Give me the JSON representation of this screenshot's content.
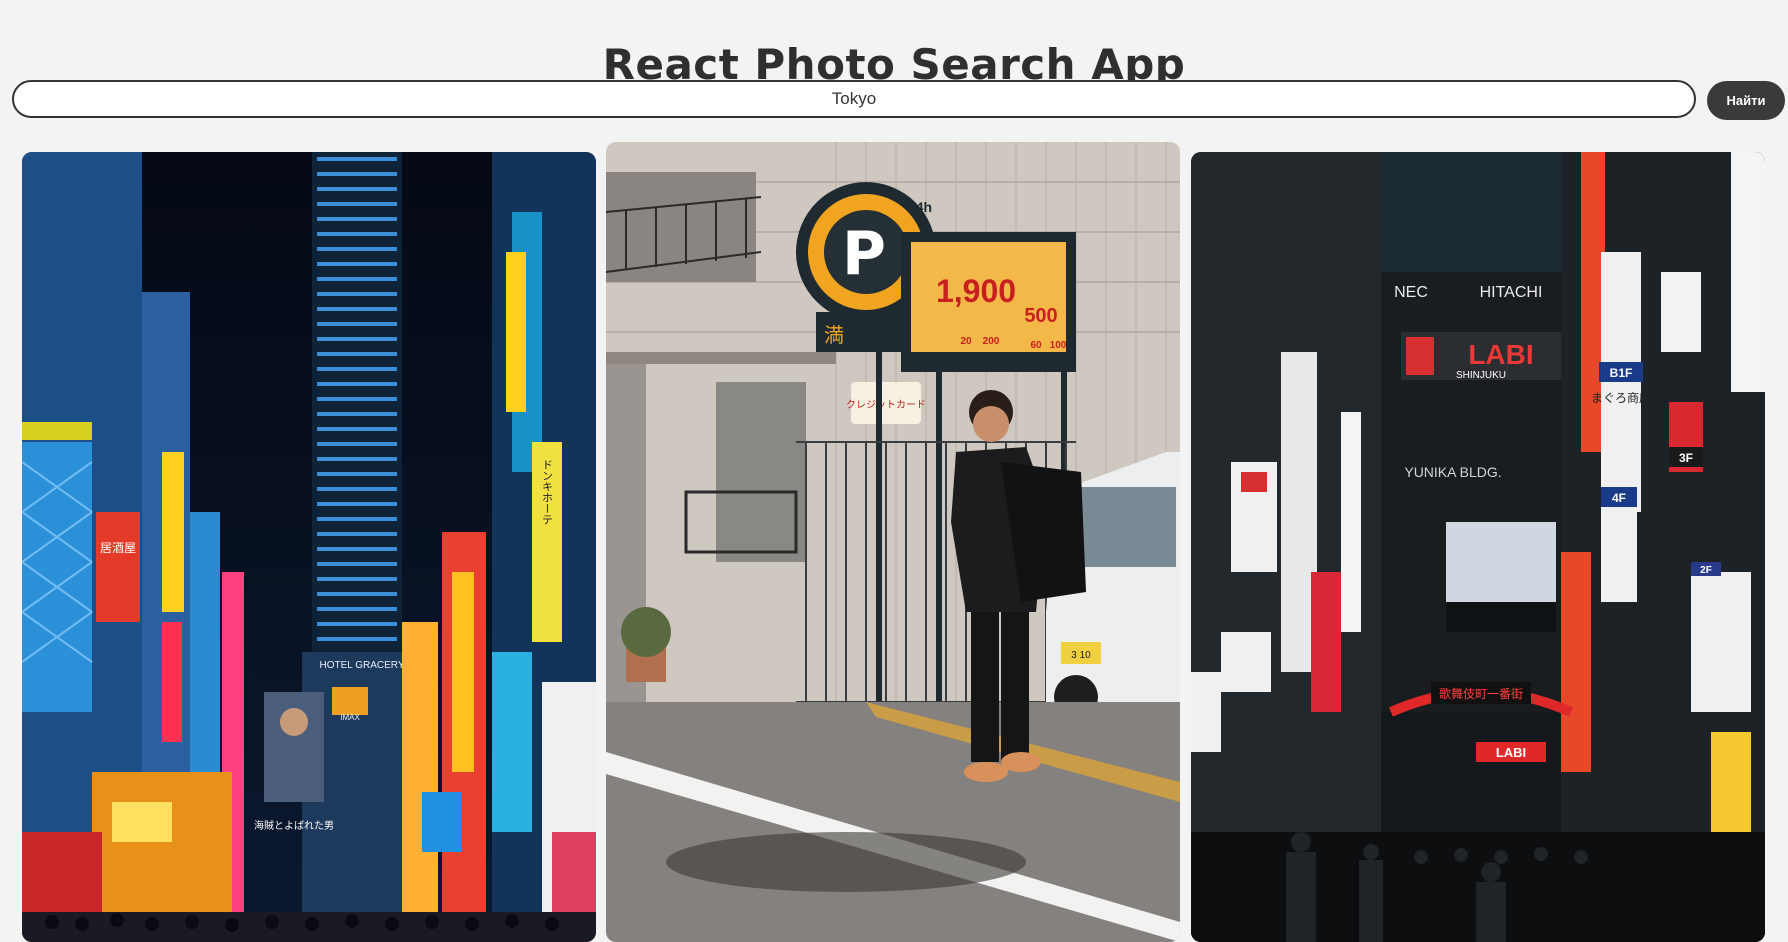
{
  "app": {
    "title": "React Photo Search App"
  },
  "search": {
    "value": "Tokyo",
    "button_label": "Найти"
  },
  "photos": [
    {
      "signs": [
        "HOTEL GRACERY",
        "IMAX",
        "ドンキホーテ",
        "居酒屋",
        "海賊とよばれた男"
      ]
    },
    {
      "signs": [
        "P",
        "24h",
        "1,900",
        "500",
        "20",
        "200",
        "60",
        "100",
        "クレジットカード",
        "満",
        "3 10"
      ]
    },
    {
      "signs": [
        "NEC",
        "HITACHI",
        "LABI",
        "SHINJUKU",
        "YUNIKA BLDG.",
        "歌舞伎町一番街",
        "まぐろ商店",
        "LABI",
        "B1F",
        "4F",
        "3F",
        "2F"
      ]
    }
  ],
  "colors": {
    "background": "#f3f3f3",
    "button_bg": "#3a3a3a",
    "button_text": "#ffffff"
  }
}
